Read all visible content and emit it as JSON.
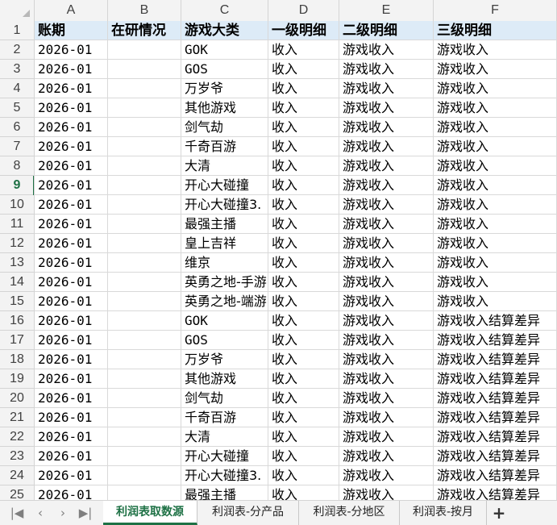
{
  "columns": [
    "A",
    "B",
    "C",
    "D",
    "E",
    "F"
  ],
  "headers": [
    "账期",
    "在研情况",
    "游戏大类",
    "一级明细",
    "二级明细",
    "三级明细"
  ],
  "selected_row": "9",
  "rows": [
    [
      "2026-01",
      "",
      "GOK",
      "收入",
      "游戏收入",
      "游戏收入"
    ],
    [
      "2026-01",
      "",
      "GOS",
      "收入",
      "游戏收入",
      "游戏收入"
    ],
    [
      "2026-01",
      "",
      "万岁爷",
      "收入",
      "游戏收入",
      "游戏收入"
    ],
    [
      "2026-01",
      "",
      "其他游戏",
      "收入",
      "游戏收入",
      "游戏收入"
    ],
    [
      "2026-01",
      "",
      "剑气劫",
      "收入",
      "游戏收入",
      "游戏收入"
    ],
    [
      "2026-01",
      "",
      "千奇百游",
      "收入",
      "游戏收入",
      "游戏收入"
    ],
    [
      "2026-01",
      "",
      "大清",
      "收入",
      "游戏收入",
      "游戏收入"
    ],
    [
      "2026-01",
      "",
      "开心大碰撞",
      "收入",
      "游戏收入",
      "游戏收入"
    ],
    [
      "2026-01",
      "",
      "开心大碰撞3.",
      "收入",
      "游戏收入",
      "游戏收入"
    ],
    [
      "2026-01",
      "",
      "最强主播",
      "收入",
      "游戏收入",
      "游戏收入"
    ],
    [
      "2026-01",
      "",
      "皇上吉祥",
      "收入",
      "游戏收入",
      "游戏收入"
    ],
    [
      "2026-01",
      "",
      "维京",
      "收入",
      "游戏收入",
      "游戏收入"
    ],
    [
      "2026-01",
      "",
      "英勇之地-手游",
      "收入",
      "游戏收入",
      "游戏收入"
    ],
    [
      "2026-01",
      "",
      "英勇之地-端游",
      "收入",
      "游戏收入",
      "游戏收入"
    ],
    [
      "2026-01",
      "",
      "GOK",
      "收入",
      "游戏收入",
      "游戏收入结算差异"
    ],
    [
      "2026-01",
      "",
      "GOS",
      "收入",
      "游戏收入",
      "游戏收入结算差异"
    ],
    [
      "2026-01",
      "",
      "万岁爷",
      "收入",
      "游戏收入",
      "游戏收入结算差异"
    ],
    [
      "2026-01",
      "",
      "其他游戏",
      "收入",
      "游戏收入",
      "游戏收入结算差异"
    ],
    [
      "2026-01",
      "",
      "剑气劫",
      "收入",
      "游戏收入",
      "游戏收入结算差异"
    ],
    [
      "2026-01",
      "",
      "千奇百游",
      "收入",
      "游戏收入",
      "游戏收入结算差异"
    ],
    [
      "2026-01",
      "",
      "大清",
      "收入",
      "游戏收入",
      "游戏收入结算差异"
    ],
    [
      "2026-01",
      "",
      "开心大碰撞",
      "收入",
      "游戏收入",
      "游戏收入结算差异"
    ],
    [
      "2026-01",
      "",
      "开心大碰撞3.",
      "收入",
      "游戏收入",
      "游戏收入结算差异"
    ],
    [
      "2026-01",
      "",
      "最强主播",
      "收入",
      "游戏收入",
      "游戏收入结算差异"
    ]
  ],
  "sheet_nav": {
    "first_icon": "first-sheet-icon",
    "prev_icon": "prev-sheet-icon",
    "next_icon": "next-sheet-icon",
    "last_icon": "last-sheet-icon",
    "first_glyph": "|◀",
    "prev_glyph": "‹",
    "next_glyph": "›",
    "last_glyph": "▶|"
  },
  "sheet_tabs": [
    "利润表取数源",
    "利润表-分产品",
    "利润表-分地区",
    "利润表-按月"
  ],
  "active_tab": 0,
  "add_sheet_label": "+",
  "colors": {
    "header_fill": "#ddebf7",
    "accent": "#1e7145",
    "gridline": "#d9d9d9",
    "chrome": "#f3f3f3"
  }
}
